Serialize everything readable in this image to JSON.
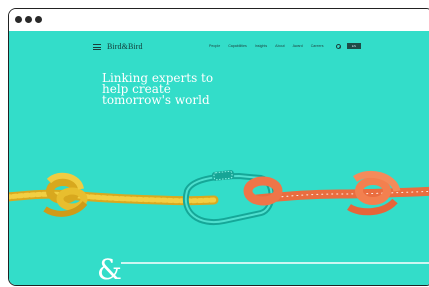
{
  "brand": {
    "name": "Bird&Bird"
  },
  "nav": {
    "items": [
      "People",
      "Capabilities",
      "Insights",
      "About",
      "Award",
      "Careers"
    ],
    "lang_label": "EN"
  },
  "hero": {
    "headline_line1": "Linking experts to",
    "headline_line2": "help create",
    "headline_line3": "tomorrow's world",
    "ampersand": "&"
  },
  "colors": {
    "background": "#33ddc9",
    "rope_left": "#e1b62c",
    "rope_right": "#f07a4c",
    "carabiner": "#19b6a6"
  }
}
